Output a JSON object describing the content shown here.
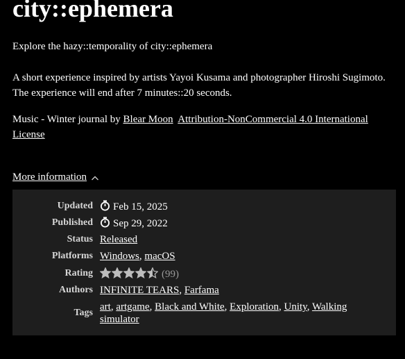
{
  "title": "city::ephemera",
  "tagline": "Explore the hazy::temporality of city::ephemera",
  "description": "A short experience inspired by artists Yayoi Kusama and photographer Hiroshi Sugimoto. The experience will end after 7 minutes::20 seconds.",
  "music": {
    "prefix": "Music - Winter journal by ",
    "artist": "Blear Moon",
    "license": "Attribution-NonCommercial 4.0 International License"
  },
  "more_info": {
    "label": "More information",
    "icon": "chevron-up-icon"
  },
  "info": {
    "updated": {
      "label": "Updated",
      "value": "Feb 15, 2025",
      "icon": "stopwatch-icon"
    },
    "published": {
      "label": "Published",
      "value": "Sep 29, 2022",
      "icon": "stopwatch-icon"
    },
    "status": {
      "label": "Status",
      "value": "Released"
    },
    "platforms": {
      "label": "Platforms",
      "items": [
        "Windows",
        "macOS"
      ]
    },
    "rating": {
      "label": "Rating",
      "stars": 4.5,
      "max": 5,
      "count": "(99)"
    },
    "authors": {
      "label": "Authors",
      "items": [
        "INFINITE TEARS",
        "Farfama"
      ]
    },
    "tags": {
      "label": "Tags",
      "items": [
        "art",
        "artgame",
        "Black and White",
        "Exploration",
        "Unity",
        "Walking simulator"
      ]
    }
  },
  "colors": {
    "background": "#000000",
    "panel": "#1e1e1e",
    "text": "#ffffff",
    "label": "#d6d6d6",
    "muted": "#9a9a9a"
  }
}
